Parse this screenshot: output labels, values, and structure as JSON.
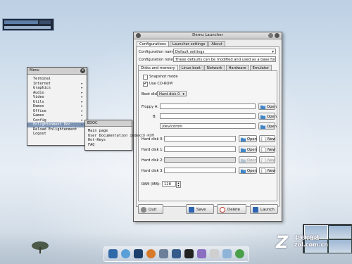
{
  "menu": {
    "title": "Menu",
    "items": [
      {
        "label": "Terminal",
        "arrow": ""
      },
      {
        "label": "Internet",
        "arrow": "►"
      },
      {
        "label": "Graphics",
        "arrow": "►"
      },
      {
        "label": "Audio",
        "arrow": "►"
      },
      {
        "label": "Video",
        "arrow": "►"
      },
      {
        "label": "Utils",
        "arrow": "►"
      },
      {
        "label": "Demos",
        "arrow": "►"
      },
      {
        "label": "Office",
        "arrow": "►"
      },
      {
        "label": "Games",
        "arrow": "►"
      },
      {
        "label": "Config",
        "arrow": "►"
      },
      {
        "label": "Enlightenment Doc",
        "arrow": "►"
      },
      {
        "label": "Reload Enlightenment",
        "arrow": ""
      },
      {
        "label": "Logout",
        "arrow": ""
      }
    ],
    "close_glyph": "x"
  },
  "submenu": {
    "title": "EDOC",
    "items": [
      "Main page",
      "User Documentation index",
      "Hot-Keys",
      "FAQ"
    ],
    "overflow_text": "CD-ROM"
  },
  "window": {
    "title": "Demu Launcher",
    "tabs": [
      "Configurations",
      "Launcher settings",
      "About"
    ],
    "config_name_label": "Configuration name",
    "config_name_value": "Default settings",
    "config_notes_label": "Configuration notes",
    "config_notes_value": "These defaults can be modified and used as a base for new c",
    "sub_tabs": [
      "Disks and memory",
      "Linux boot",
      "Network",
      "Hardware",
      "Emulator"
    ],
    "snapshot_label": "Snapshot mode",
    "use_cdrom_label": "Use CD-ROM",
    "use_cdrom_mark": "✔",
    "boot_disk_label": "Boot disk",
    "boot_disk_value": "Hard disk 0",
    "floppy_a_label": "Floppy A:",
    "floppy_b_label": "B:",
    "cdrom_label": "CD-ROM:",
    "cdrom_value": "/dev/cdrom",
    "hd0_label": "Hard disk 0:",
    "hd1_label": "Hard disk 1:",
    "hd2_label": "Hard disk 2:",
    "hd3_label": "Hard disk 3:",
    "open_label": "Open",
    "new_label": "New",
    "ram_label": "RAM (MB):",
    "ram_value": "128",
    "quit_label": "Quit",
    "save_label": "Save",
    "delete_label": "Delete",
    "launch_label": "Launch"
  },
  "watermark": {
    "brand": "中关村在线",
    "site": "zol.com.cn",
    "letter": "Z"
  },
  "colors": {
    "accent": "#7c93b3",
    "open_icon": "#3f86c8",
    "quit_icon": "#888888",
    "save_icon": "#2d64b0",
    "delete_icon": "#c0392b",
    "launch_icon": "#2d64b0"
  }
}
